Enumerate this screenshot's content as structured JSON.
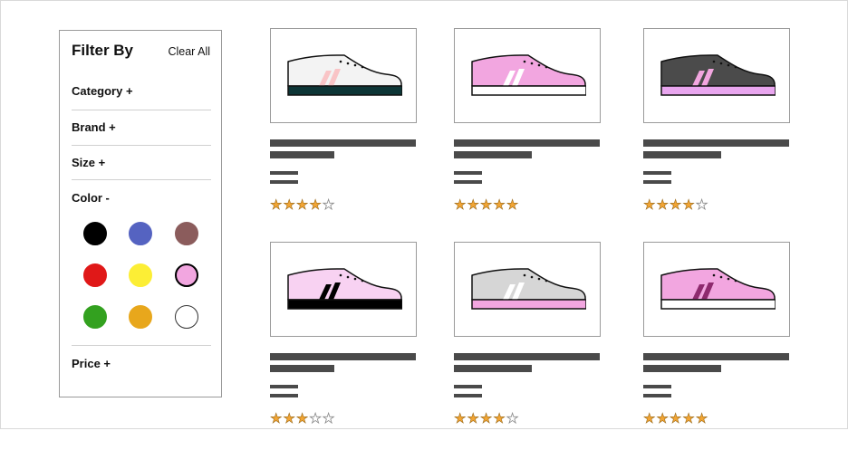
{
  "filter": {
    "title": "Filter By",
    "clear_label": "Clear All",
    "sections": {
      "category": "Category +",
      "brand": "Brand +",
      "size": "Size +",
      "color": "Color -",
      "price": "Price +"
    },
    "colors": [
      {
        "name": "black",
        "hex": "#000000",
        "selected": false
      },
      {
        "name": "blue",
        "hex": "#5563c1",
        "selected": false
      },
      {
        "name": "brown",
        "hex": "#8b5c5c",
        "selected": false
      },
      {
        "name": "red",
        "hex": "#e01818",
        "selected": false
      },
      {
        "name": "yellow",
        "hex": "#fcee35",
        "selected": false
      },
      {
        "name": "pink",
        "hex": "#f2a6e0",
        "selected": true
      },
      {
        "name": "green",
        "hex": "#33a11f",
        "selected": false
      },
      {
        "name": "orange",
        "hex": "#e8a71c",
        "selected": false
      },
      {
        "name": "white",
        "hex": "#ffffff",
        "selected": false
      }
    ]
  },
  "products": [
    {
      "icon": "sneaker-icon",
      "upper": "#f3f3f3",
      "sole": "#0d3536",
      "stripes": "#f9c4c6",
      "rating": 4
    },
    {
      "icon": "sneaker-icon",
      "upper": "#f2a6e0",
      "sole": "#ffffff",
      "stripes": "#ffffff",
      "rating": 5
    },
    {
      "icon": "sneaker-icon",
      "upper": "#4b4b4b",
      "sole": "#e9a6ef",
      "stripes": "#f2a6e0",
      "rating": 4
    },
    {
      "icon": "sneaker-icon",
      "upper": "#f8d2f2",
      "sole": "#000000",
      "stripes": "#000000",
      "rating": 3
    },
    {
      "icon": "sneaker-icon",
      "upper": "#d6d6d6",
      "sole": "#f2a6e0",
      "stripes": "#ffffff",
      "rating": 4
    },
    {
      "icon": "sneaker-icon",
      "upper": "#f2a6e0",
      "sole": "#ffffff",
      "stripes": "#8e2a6e",
      "rating": 5
    }
  ]
}
